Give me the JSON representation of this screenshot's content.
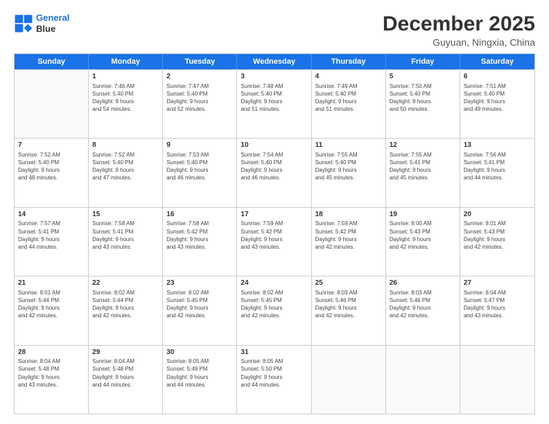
{
  "logo": {
    "line1": "General",
    "line2": "Blue"
  },
  "title": "December 2025",
  "subtitle": "Guyuan, Ningxia, China",
  "days": [
    "Sunday",
    "Monday",
    "Tuesday",
    "Wednesday",
    "Thursday",
    "Friday",
    "Saturday"
  ],
  "weeks": [
    [
      {
        "day": "",
        "info": ""
      },
      {
        "day": "1",
        "info": "Sunrise: 7:46 AM\nSunset: 5:40 PM\nDaylight: 9 hours\nand 54 minutes."
      },
      {
        "day": "2",
        "info": "Sunrise: 7:47 AM\nSunset: 5:40 PM\nDaylight: 9 hours\nand 52 minutes."
      },
      {
        "day": "3",
        "info": "Sunrise: 7:48 AM\nSunset: 5:40 PM\nDaylight: 9 hours\nand 51 minutes."
      },
      {
        "day": "4",
        "info": "Sunrise: 7:49 AM\nSunset: 5:40 PM\nDaylight: 9 hours\nand 51 minutes."
      },
      {
        "day": "5",
        "info": "Sunrise: 7:50 AM\nSunset: 5:40 PM\nDaylight: 9 hours\nand 50 minutes."
      },
      {
        "day": "6",
        "info": "Sunrise: 7:51 AM\nSunset: 5:40 PM\nDaylight: 9 hours\nand 49 minutes."
      }
    ],
    [
      {
        "day": "7",
        "info": "Sunrise: 7:52 AM\nSunset: 5:40 PM\nDaylight: 9 hours\nand 48 minutes."
      },
      {
        "day": "8",
        "info": "Sunrise: 7:52 AM\nSunset: 5:40 PM\nDaylight: 9 hours\nand 47 minutes."
      },
      {
        "day": "9",
        "info": "Sunrise: 7:53 AM\nSunset: 5:40 PM\nDaylight: 9 hours\nand 46 minutes."
      },
      {
        "day": "10",
        "info": "Sunrise: 7:54 AM\nSunset: 5:40 PM\nDaylight: 9 hours\nand 46 minutes."
      },
      {
        "day": "11",
        "info": "Sunrise: 7:55 AM\nSunset: 5:40 PM\nDaylight: 9 hours\nand 45 minutes."
      },
      {
        "day": "12",
        "info": "Sunrise: 7:55 AM\nSunset: 5:41 PM\nDaylight: 9 hours\nand 45 minutes."
      },
      {
        "day": "13",
        "info": "Sunrise: 7:56 AM\nSunset: 5:41 PM\nDaylight: 9 hours\nand 44 minutes."
      }
    ],
    [
      {
        "day": "14",
        "info": "Sunrise: 7:57 AM\nSunset: 5:41 PM\nDaylight: 9 hours\nand 44 minutes."
      },
      {
        "day": "15",
        "info": "Sunrise: 7:58 AM\nSunset: 5:41 PM\nDaylight: 9 hours\nand 43 minutes."
      },
      {
        "day": "16",
        "info": "Sunrise: 7:58 AM\nSunset: 5:42 PM\nDaylight: 9 hours\nand 43 minutes."
      },
      {
        "day": "17",
        "info": "Sunrise: 7:59 AM\nSunset: 5:42 PM\nDaylight: 9 hours\nand 43 minutes."
      },
      {
        "day": "18",
        "info": "Sunrise: 7:59 AM\nSunset: 5:42 PM\nDaylight: 9 hours\nand 42 minutes."
      },
      {
        "day": "19",
        "info": "Sunrise: 8:00 AM\nSunset: 5:43 PM\nDaylight: 9 hours\nand 42 minutes."
      },
      {
        "day": "20",
        "info": "Sunrise: 8:01 AM\nSunset: 5:43 PM\nDaylight: 9 hours\nand 42 minutes."
      }
    ],
    [
      {
        "day": "21",
        "info": "Sunrise: 8:01 AM\nSunset: 5:44 PM\nDaylight: 9 hours\nand 42 minutes."
      },
      {
        "day": "22",
        "info": "Sunrise: 8:02 AM\nSunset: 5:44 PM\nDaylight: 9 hours\nand 42 minutes."
      },
      {
        "day": "23",
        "info": "Sunrise: 8:02 AM\nSunset: 5:45 PM\nDaylight: 9 hours\nand 42 minutes."
      },
      {
        "day": "24",
        "info": "Sunrise: 8:02 AM\nSunset: 5:45 PM\nDaylight: 9 hours\nand 42 minutes."
      },
      {
        "day": "25",
        "info": "Sunrise: 8:03 AM\nSunset: 5:46 PM\nDaylight: 9 hours\nand 42 minutes."
      },
      {
        "day": "26",
        "info": "Sunrise: 8:03 AM\nSunset: 5:46 PM\nDaylight: 9 hours\nand 42 minutes."
      },
      {
        "day": "27",
        "info": "Sunrise: 8:04 AM\nSunset: 5:47 PM\nDaylight: 9 hours\nand 43 minutes."
      }
    ],
    [
      {
        "day": "28",
        "info": "Sunrise: 8:04 AM\nSunset: 5:48 PM\nDaylight: 9 hours\nand 43 minutes."
      },
      {
        "day": "29",
        "info": "Sunrise: 8:04 AM\nSunset: 5:48 PM\nDaylight: 9 hours\nand 44 minutes."
      },
      {
        "day": "30",
        "info": "Sunrise: 8:05 AM\nSunset: 5:49 PM\nDaylight: 9 hours\nand 44 minutes."
      },
      {
        "day": "31",
        "info": "Sunrise: 8:05 AM\nSunset: 5:50 PM\nDaylight: 9 hours\nand 44 minutes."
      },
      {
        "day": "",
        "info": ""
      },
      {
        "day": "",
        "info": ""
      },
      {
        "day": "",
        "info": ""
      }
    ]
  ]
}
